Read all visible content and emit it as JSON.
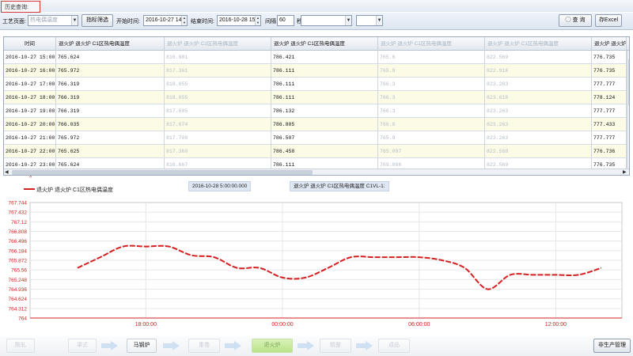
{
  "title": "历史查询:",
  "toolbar": {
    "process_label": "工艺页面:",
    "process_value": "热电偶温度",
    "filter_button": "指标筛选",
    "start_label": "开始时间:",
    "start_value": "2016-10-27 14",
    "end_label": "结束时间:",
    "end_value": "2016-10-28 15",
    "interval_label": "间隔",
    "interval_value": "60",
    "interval_unit": "秒",
    "query_button": "查 询",
    "export_button": "存Excel"
  },
  "grid": {
    "headers": [
      "时间",
      "退火炉 退火炉 C1区热电偶温度",
      "退火炉 退火炉 C1区热电偶温度",
      "退火炉 退火炉 C1区热电偶温度",
      "退火炉 退火炉 C1区热电偶温度",
      "退火炉 退火炉 C1区热电偶温度",
      "退火炉 退火炉"
    ],
    "rows": [
      [
        "2016-10-27 15:00:00",
        "765.624",
        "816.981",
        "786.421",
        "765.6",
        "822.569",
        "776.735"
      ],
      [
        "2016-10-27 16:00:00",
        "765.972",
        "817.361",
        "786.111",
        "765.9",
        "822.916",
        "776.735"
      ],
      [
        "2016-10-27 17:00:00",
        "766.319",
        "818.055",
        "786.111",
        "766.3",
        "823.263",
        "777.777"
      ],
      [
        "2016-10-27 18:00:00",
        "766.319",
        "818.055",
        "786.111",
        "766.3",
        "823.610",
        "778.124"
      ],
      [
        "2016-10-27 19:00:00",
        "766.319",
        "817.685",
        "786.132",
        "766.3",
        "823.263",
        "777.777"
      ],
      [
        "2016-10-27 20:00:00",
        "766.035",
        "817.674",
        "786.805",
        "766.0",
        "823.263",
        "777.433"
      ],
      [
        "2016-10-27 21:00:00",
        "765.972",
        "817.708",
        "786.507",
        "765.9",
        "823.263",
        "777.777"
      ],
      [
        "2016-10-27 22:00:00",
        "765.625",
        "817.360",
        "786.458",
        "765.097",
        "822.568",
        "776.736"
      ],
      [
        "2016-10-27 23:00:00",
        "765.624",
        "816.667",
        "786.111",
        "769.096",
        "822.569",
        "776.735"
      ]
    ]
  },
  "chart": {
    "legend": "退火炉 退火炉 C1区热电偶温度",
    "cursor_time": "2016-10-28 5:00:00.000",
    "cursor_series": "退火炉 退火炉 C1区热电偶温度 C1VL-1:"
  },
  "chart_data": {
    "type": "line",
    "x": [
      "15:00",
      "16:00",
      "17:00",
      "18:00",
      "19:00",
      "20:00",
      "21:00",
      "22:00",
      "23:00",
      "00:00",
      "01:00",
      "02:00",
      "03:00",
      "04:00",
      "05:00",
      "06:00",
      "07:00",
      "08:00",
      "09:00",
      "10:00",
      "11:00",
      "12:00",
      "13:00",
      "14:00"
    ],
    "series": [
      {
        "name": "退火炉 退火炉 C1区热电偶温度",
        "values": [
          765.624,
          765.972,
          766.319,
          766.319,
          766.319,
          766.035,
          765.972,
          765.625,
          765.624,
          765.31,
          765.31,
          765.624,
          765.972,
          765.972,
          765.972,
          765.972,
          765.872,
          765.624,
          764.936,
          765.4,
          765.4,
          765.4,
          765.4,
          765.624
        ]
      }
    ],
    "yticks": [
      "767.744",
      "767.432",
      "767.12",
      "766.808",
      "766.496",
      "766.184",
      "765.872",
      "765.56",
      "765.248",
      "764.936",
      "764.624",
      "764.312",
      "764"
    ],
    "xticks": [
      "18:00:00",
      "00:00:00",
      "06:00:00",
      "12:00:00"
    ],
    "ylim": [
      764,
      767.744
    ],
    "grid": true,
    "line_color": "#d42020"
  },
  "flow": {
    "steps": [
      "酸轧",
      "罩式",
      "平整",
      "马钢炉",
      "重卷",
      "退火炉",
      "精整",
      "成品"
    ],
    "right_button": "非生产管理"
  }
}
